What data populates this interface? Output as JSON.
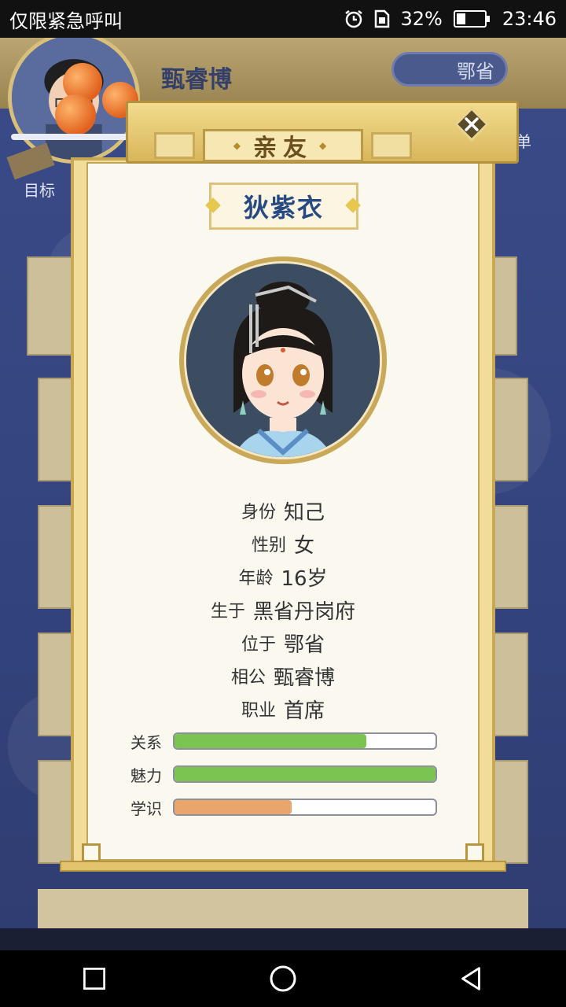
{
  "status_bar": {
    "carrier": "仅限紧急呼叫",
    "battery": "32%",
    "battery_level": 0.32,
    "time": "23:46"
  },
  "background": {
    "player_name": "甄睿博",
    "province": "鄂省",
    "menu_label": "菜单",
    "goal_label": "目标"
  },
  "dialog": {
    "title": "亲友",
    "person_name": "狄紫衣",
    "info": [
      {
        "label": "身份",
        "value": "知己"
      },
      {
        "label": "性别",
        "value": "女"
      },
      {
        "label": "年龄",
        "value": "16岁"
      },
      {
        "label": "生于",
        "value": "黑省丹岗府"
      },
      {
        "label": "位于",
        "value": "鄂省"
      },
      {
        "label": "相公",
        "value": "甄睿博"
      },
      {
        "label": "职业",
        "value": "首席"
      }
    ],
    "stats": [
      {
        "label": "关系",
        "value": 0.735,
        "color": "#7cc452"
      },
      {
        "label": "魅力",
        "value": 1.0,
        "color": "#7cc452"
      },
      {
        "label": "学识",
        "value": 0.45,
        "color": "#eaa66a"
      }
    ]
  },
  "icons": {
    "alarm": "alarm-icon",
    "sim": "no-sim-icon",
    "close": "close-icon",
    "nav_recent": "square-icon",
    "nav_home": "circle-icon",
    "nav_back": "triangle-back-icon"
  }
}
